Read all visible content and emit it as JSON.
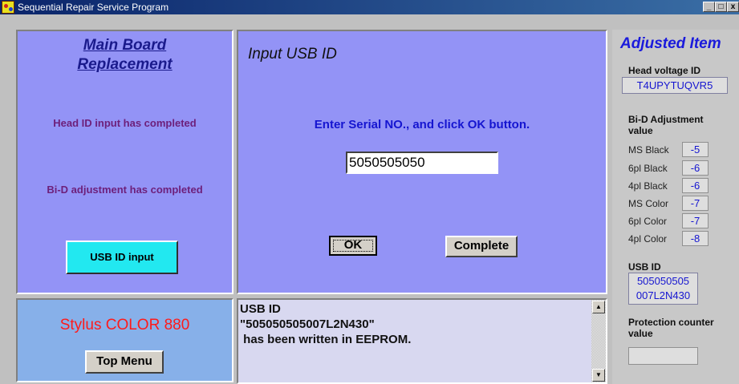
{
  "window": {
    "title": "Sequential Repair Service Program",
    "controls": [
      "_",
      "□",
      "x"
    ]
  },
  "left_panel": {
    "title_line1": "Main Board",
    "title_line2": "Replacement",
    "status1": "Head ID input has completed",
    "status2": "Bi-D adjustment has completed",
    "usb_button": "USB ID input"
  },
  "center_panel": {
    "title": "Input USB ID",
    "instruction": "Enter Serial NO., and click OK button.",
    "serial_value": "5050505050",
    "ok_button": "OK",
    "complete_button": "Complete"
  },
  "model_panel": {
    "model": "Stylus COLOR 880",
    "top_menu_button": "Top Menu"
  },
  "log_panel": {
    "text": "USB ID\n\"505050505007L2N430\"\n has been written in EEPROM."
  },
  "right_panel": {
    "title": "Adjusted Item",
    "head_voltage_label": "Head voltage ID",
    "head_voltage_value": "T4UPYTUQVR5",
    "bid_label_line1": "Bi-D Adjustment",
    "bid_label_line2": "value",
    "bid_rows": [
      {
        "label": "MS Black",
        "value": "-5"
      },
      {
        "label": "6pl Black",
        "value": "-6"
      },
      {
        "label": "4pl Black",
        "value": "-6"
      },
      {
        "label": "MS Color",
        "value": "-7"
      },
      {
        "label": "6pl Color",
        "value": "-7"
      },
      {
        "label": "4pl Color",
        "value": "-8"
      }
    ],
    "usb_id_label": "USB ID",
    "usb_id_line1": "505050505",
    "usb_id_line2": "007L2N430",
    "protection_label_line1": "Protection counter",
    "protection_label_line2": "value",
    "protection_value": ""
  },
  "colors": {
    "panel_purple": "#9393f6",
    "panel_blue": "#87b0e9",
    "accent_cyan": "#22e8f0",
    "model_red": "#ff1a1a",
    "instruction_blue": "#1515d0",
    "status_purple": "#6d1f7a"
  }
}
